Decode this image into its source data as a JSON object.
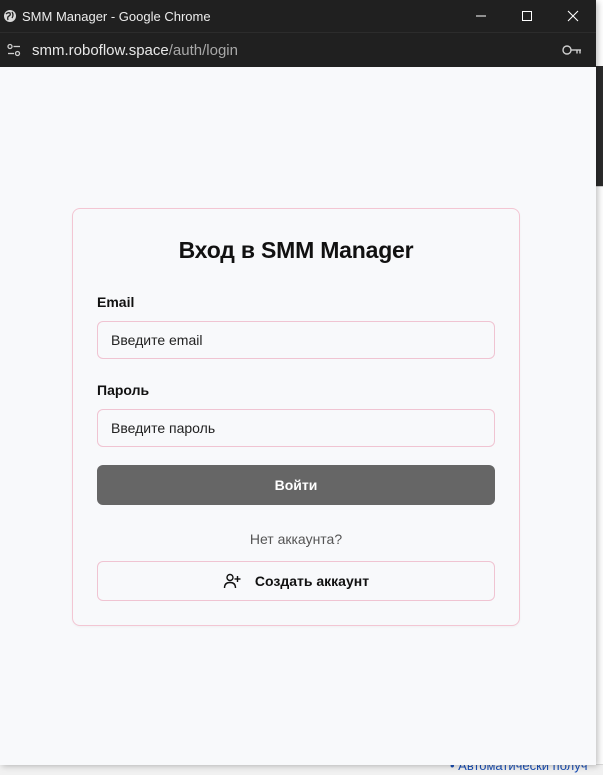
{
  "window": {
    "title": "SMM Manager - Google Chrome",
    "url_host": "smm.roboflow.space",
    "url_path": "/auth/login"
  },
  "login": {
    "heading": "Вход в SMM Manager",
    "email_label": "Email",
    "email_placeholder": "Введите email",
    "password_label": "Пароль",
    "password_placeholder": "Введите пароль",
    "submit_label": "Войти",
    "no_account_text": "Нет аккаунта?",
    "create_account_label": "Создать аккаунт"
  },
  "background": {
    "bottom_link_text": "• Автоматически получ"
  },
  "colors": {
    "titlebar": "#202020",
    "page_bg": "#f8f9fb",
    "card_border": "#f3c6d3",
    "submit_bg": "#666666"
  },
  "icons": {
    "window_icon": "globe-icon",
    "site_info": "tune-icon",
    "password_manager": "key-icon",
    "create_account": "user-plus-icon"
  }
}
